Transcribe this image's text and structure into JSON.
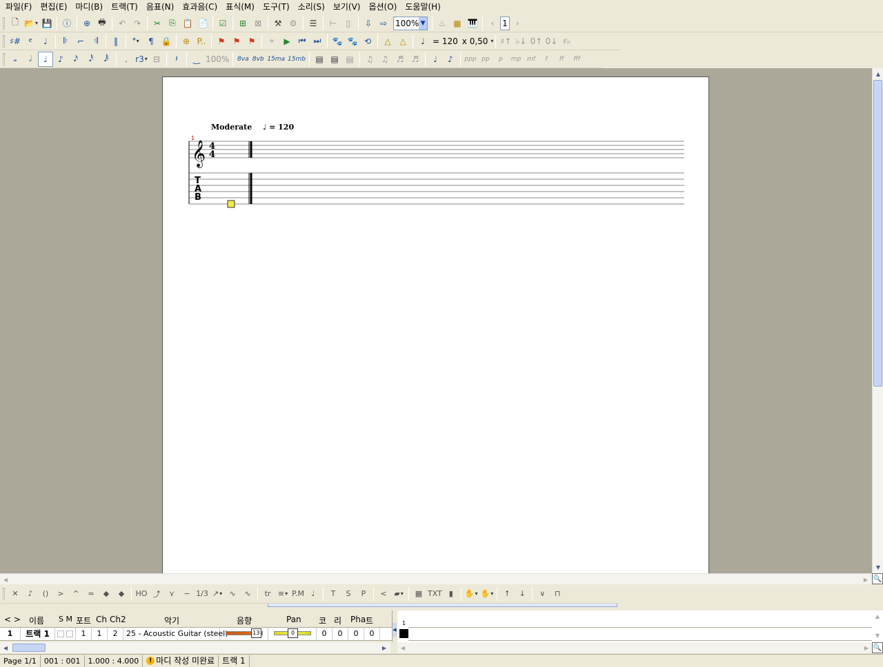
{
  "menu": [
    "파일(F)",
    "편집(E)",
    "마디(B)",
    "트랙(T)",
    "음표(N)",
    "효과음(C)",
    "표식(M)",
    "도구(T)",
    "소리(S)",
    "보기(V)",
    "옵션(O)",
    "도움말(H)"
  ],
  "toolbar_main": {
    "zoom_value": "100%",
    "page_number": "1"
  },
  "toolbar_notation": {
    "tempo_value": "= 120",
    "speed_value": "x 0,50"
  },
  "toolbar_duration": {
    "tuplet_label": "r3",
    "velocity_percent": "100%",
    "ottava": [
      "8va",
      "8vb",
      "15ma",
      "15mb"
    ],
    "dynamics": [
      "ppp",
      "pp",
      "p",
      "mp",
      "mf",
      "f",
      "ff",
      "fff"
    ]
  },
  "toolbar_effects": {
    "labels": [
      "HO",
      "1/3",
      "tr",
      "P.M",
      "T",
      "S",
      "P",
      "TXT"
    ]
  },
  "score": {
    "tempo_text": "Moderate",
    "tempo_number": "= 120",
    "measure_number": "1",
    "time_sig_top": "4",
    "time_sig_bottom": "4",
    "tab_letters": [
      "T",
      "A",
      "B"
    ]
  },
  "track_panel": {
    "headers": {
      "nav": "< >",
      "name": "이름",
      "sm": "S M",
      "port": "포트",
      "ch": "Ch",
      "ch2": "Ch2",
      "instrument": "악기",
      "volume": "음향",
      "pan": "Pan",
      "chorus": "코",
      "reverb": "리",
      "phaser": "Pha",
      "tremolo": "트"
    },
    "track": {
      "number": "1",
      "name": "트랙 1",
      "port": "1",
      "ch": "1",
      "ch2": "2",
      "instrument": "25 - Acoustic Guitar (steel)",
      "volume": "13",
      "volume_level": 0.8125,
      "pan": "0",
      "pan_level": 0.5,
      "chorus": "0",
      "reverb": "0",
      "phaser": "0",
      "tremolo": "0"
    }
  },
  "timeline": {
    "measure_label": "1"
  },
  "status": {
    "page": "Page 1/1",
    "position": "001 : 001",
    "time": "1.000 : 4.000",
    "warning": "마디 작성 미완료",
    "track": "트랙 1"
  },
  "colors": {
    "workspace": "#aca899",
    "ui_face": "#ece9d8",
    "cursor_box": "#f5e84a",
    "accent_blue": "#1d4f9c"
  }
}
